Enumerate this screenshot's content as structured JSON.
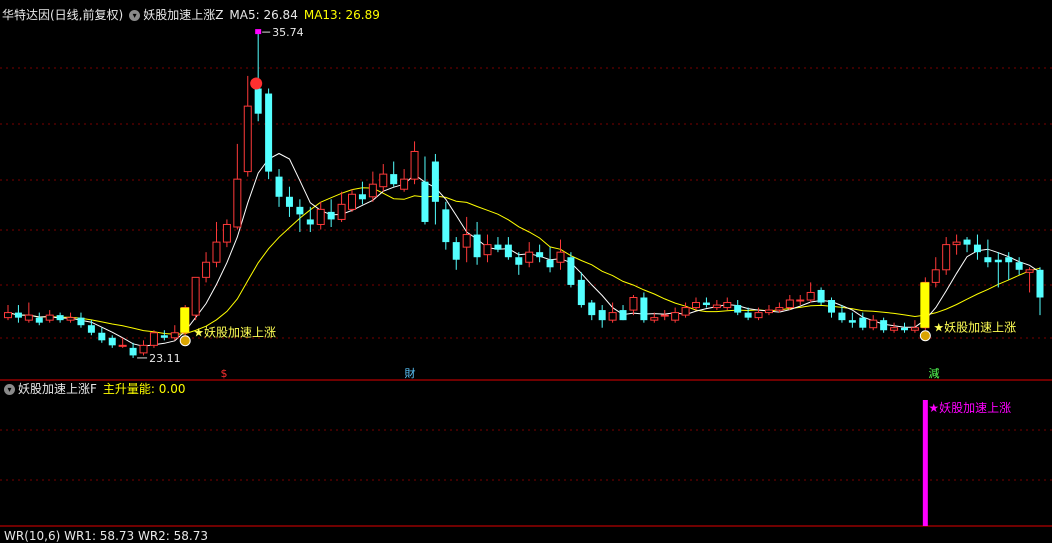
{
  "header_main": {
    "stock_name": "华特达因(日线,前复权)",
    "indicator_name": "妖股加速上涨Z",
    "ma5_label": "MA5: 26.84",
    "ma13_label": "MA13: 26.89"
  },
  "header_sub": {
    "indicator_name": "妖股加速上涨F",
    "value_label": "主升量能: 0.00"
  },
  "header_bottom": {
    "text": "WR(10,6) WR1: 58.73 WR2: 58.73"
  },
  "colors": {
    "up": "#ff3a3a",
    "down": "#54ffff",
    "ma5": "#ffffff",
    "ma13": "#ffff00",
    "grid": "#7a0000",
    "signal_bar": "#ffff00",
    "magenta": "#ff00ff",
    "marker_text": "#ffff55"
  },
  "markers": {
    "high_label": "35.74",
    "low_label": "23.11",
    "signal_label_1": "★妖股加速上涨",
    "signal_label_2": "★妖股加速上涨",
    "sub_signal_label": "★妖股加速上涨",
    "icon_1": "$",
    "icon_2": "財",
    "icon_3": "減"
  },
  "chart_data": {
    "type": "candlestick",
    "price_scale": {
      "min": 22.4,
      "max": 36.3
    },
    "candles": [
      [
        24.4,
        24.6,
        24.9,
        24.3
      ],
      [
        24.6,
        24.4,
        24.9,
        24.2
      ],
      [
        24.3,
        24.5,
        25.0,
        24.2
      ],
      [
        24.4,
        24.2,
        24.6,
        24.1
      ],
      [
        24.3,
        24.5,
        24.7,
        24.2
      ],
      [
        24.5,
        24.3,
        24.6,
        24.2
      ],
      [
        24.3,
        24.4,
        24.6,
        24.2
      ],
      [
        24.4,
        24.1,
        24.6,
        24.0
      ],
      [
        24.1,
        23.8,
        24.3,
        23.7
      ],
      [
        23.8,
        23.5,
        24.0,
        23.4
      ],
      [
        23.6,
        23.3,
        23.7,
        23.2
      ],
      [
        23.3,
        23.3,
        23.6,
        23.2
      ],
      [
        23.2,
        22.9,
        23.4,
        22.8
      ],
      [
        23.0,
        23.3,
        23.5,
        22.9
      ],
      [
        23.3,
        23.8,
        23.9,
        23.2
      ],
      [
        23.7,
        23.6,
        23.9,
        23.5
      ],
      [
        23.6,
        23.8,
        24.1,
        23.5
      ],
      [
        23.8,
        24.8,
        24.9,
        23.7
      ],
      [
        24.5,
        26.0,
        26.0,
        24.3
      ],
      [
        26.0,
        26.6,
        27.0,
        25.8
      ],
      [
        26.6,
        27.4,
        28.2,
        26.4
      ],
      [
        27.4,
        28.1,
        28.3,
        27.2
      ],
      [
        28.0,
        29.9,
        31.3,
        27.9
      ],
      [
        30.2,
        32.8,
        34.0,
        30.0
      ],
      [
        33.5,
        32.5,
        35.74,
        32.2
      ],
      [
        33.3,
        30.2,
        33.5,
        29.9
      ],
      [
        30.0,
        29.2,
        30.3,
        28.8
      ],
      [
        29.2,
        28.8,
        29.6,
        28.4
      ],
      [
        28.8,
        28.5,
        29.1,
        27.8
      ],
      [
        28.3,
        28.1,
        28.8,
        27.8
      ],
      [
        28.1,
        28.7,
        29.0,
        27.9
      ],
      [
        28.6,
        28.3,
        29.1,
        28.0
      ],
      [
        28.3,
        28.9,
        29.4,
        28.2
      ],
      [
        28.7,
        29.3,
        29.5,
        28.6
      ],
      [
        29.3,
        29.1,
        29.8,
        28.9
      ],
      [
        29.2,
        29.7,
        30.2,
        29.0
      ],
      [
        29.6,
        30.1,
        30.5,
        29.4
      ],
      [
        30.1,
        29.7,
        30.6,
        29.6
      ],
      [
        29.5,
        29.9,
        30.3,
        29.4
      ],
      [
        29.9,
        31.0,
        31.4,
        29.7
      ],
      [
        29.8,
        28.2,
        30.8,
        28.1
      ],
      [
        30.6,
        29.0,
        30.9,
        28.1
      ],
      [
        28.7,
        27.4,
        29.0,
        27.1
      ],
      [
        27.4,
        26.7,
        27.6,
        26.3
      ],
      [
        27.2,
        27.7,
        28.4,
        26.6
      ],
      [
        27.7,
        26.8,
        28.2,
        26.5
      ],
      [
        26.9,
        27.3,
        27.7,
        26.6
      ],
      [
        27.3,
        27.1,
        27.6,
        27.0
      ],
      [
        27.3,
        26.8,
        27.6,
        26.7
      ],
      [
        26.8,
        26.5,
        27.0,
        26.1
      ],
      [
        26.6,
        27.0,
        27.4,
        26.4
      ],
      [
        27.0,
        26.8,
        27.3,
        26.6
      ],
      [
        26.7,
        26.4,
        27.2,
        26.2
      ],
      [
        26.6,
        27.0,
        27.5,
        26.3
      ],
      [
        26.8,
        25.7,
        27.0,
        25.6
      ],
      [
        25.9,
        24.9,
        26.2,
        24.8
      ],
      [
        25.0,
        24.5,
        25.1,
        24.3
      ],
      [
        24.7,
        24.3,
        24.9,
        24.0
      ],
      [
        24.3,
        24.6,
        25.0,
        24.2
      ],
      [
        24.7,
        24.3,
        24.9,
        24.3
      ],
      [
        24.7,
        25.2,
        25.3,
        24.5
      ],
      [
        25.2,
        24.3,
        25.4,
        24.2
      ],
      [
        24.3,
        24.4,
        24.6,
        24.2
      ],
      [
        24.5,
        24.5,
        24.7,
        24.3
      ],
      [
        24.3,
        24.6,
        24.8,
        24.2
      ],
      [
        24.5,
        24.8,
        25.0,
        24.4
      ],
      [
        24.8,
        25.0,
        25.2,
        24.7
      ],
      [
        25.0,
        24.9,
        25.2,
        24.8
      ],
      [
        24.8,
        24.9,
        25.1,
        24.7
      ],
      [
        24.8,
        25.0,
        25.2,
        24.7
      ],
      [
        24.9,
        24.6,
        25.1,
        24.5
      ],
      [
        24.6,
        24.4,
        24.8,
        24.3
      ],
      [
        24.4,
        24.6,
        24.8,
        24.3
      ],
      [
        24.6,
        24.7,
        24.9,
        24.5
      ],
      [
        24.7,
        24.8,
        25.0,
        24.6
      ],
      [
        24.8,
        25.1,
        25.3,
        24.7
      ],
      [
        25.1,
        25.1,
        25.3,
        24.9
      ],
      [
        25.1,
        25.4,
        25.8,
        25.0
      ],
      [
        25.5,
        25.0,
        25.6,
        24.9
      ],
      [
        25.1,
        24.6,
        25.2,
        24.4
      ],
      [
        24.6,
        24.3,
        24.9,
        24.2
      ],
      [
        24.3,
        24.2,
        24.6,
        24.0
      ],
      [
        24.4,
        24.0,
        24.6,
        23.9
      ],
      [
        24.0,
        24.3,
        24.5,
        23.9
      ],
      [
        24.3,
        23.9,
        24.4,
        23.8
      ],
      [
        23.9,
        24.0,
        24.2,
        23.8
      ],
      [
        24.0,
        23.9,
        24.2,
        23.8
      ],
      [
        23.9,
        24.0,
        24.3,
        23.8
      ],
      [
        24.0,
        25.8,
        26.0,
        23.9
      ],
      [
        25.8,
        26.3,
        26.8,
        25.6
      ],
      [
        26.3,
        27.3,
        27.6,
        26.1
      ],
      [
        27.3,
        27.4,
        27.7,
        26.9
      ],
      [
        27.5,
        27.3,
        27.6,
        27.0
      ],
      [
        27.3,
        27.0,
        27.7,
        26.7
      ],
      [
        26.8,
        26.6,
        27.5,
        26.4
      ],
      [
        26.7,
        26.6,
        27.0,
        25.6
      ],
      [
        26.8,
        26.6,
        27.0,
        25.9
      ],
      [
        26.6,
        26.3,
        26.8,
        26.1
      ],
      [
        26.2,
        26.3,
        26.4,
        25.4
      ],
      [
        26.3,
        25.2,
        26.4,
        24.5
      ]
    ],
    "signal_candle_indices": [
      17,
      88
    ],
    "sub_chart": {
      "series_name": "主升量能",
      "value_at_signal": 1,
      "signal_index": 88
    }
  }
}
